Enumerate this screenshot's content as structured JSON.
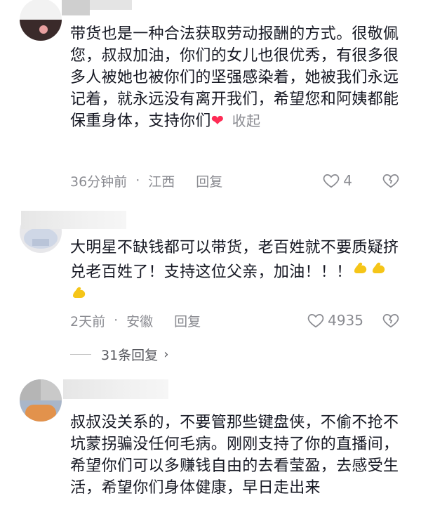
{
  "comments": [
    {
      "text": "带货也是一种合法获取劳动报酬的方式。很敬佩您，叔叔加油，你们的女儿也很优秀，有很多很多人被她也被你们的坚强感染着，她被我们永远记着，就永远没有离开我们，希望您和阿姨都能保重身体，支持你们",
      "emoji": "❤",
      "collapse_label": "收起",
      "time": "36分钟前",
      "location": "江西",
      "reply_label": "回复",
      "likes": "4"
    },
    {
      "text": "大明星不缺钱都可以带货，老百姓就不要质疑挤兑老百姓了！支持这位父亲，加油！！！",
      "emoji": "💪💪💪",
      "time": "2天前",
      "location": "安徽",
      "reply_label": "回复",
      "likes": "4935",
      "more_replies": "31条回复"
    },
    {
      "text": "叔叔没关系的，不要管那些键盘侠，不偷不抢不坑蒙拐骗没任何毛病。刚刚支持了你的直播间，希望你们可以多赚钱自由的去看莹盈，去感受生活，希望你们身体健康，早日走出来"
    }
  ],
  "colors": {
    "text": "#161823",
    "meta": "#8a8b91",
    "heart": "#fe2c55",
    "muscle": "#f5c518"
  }
}
